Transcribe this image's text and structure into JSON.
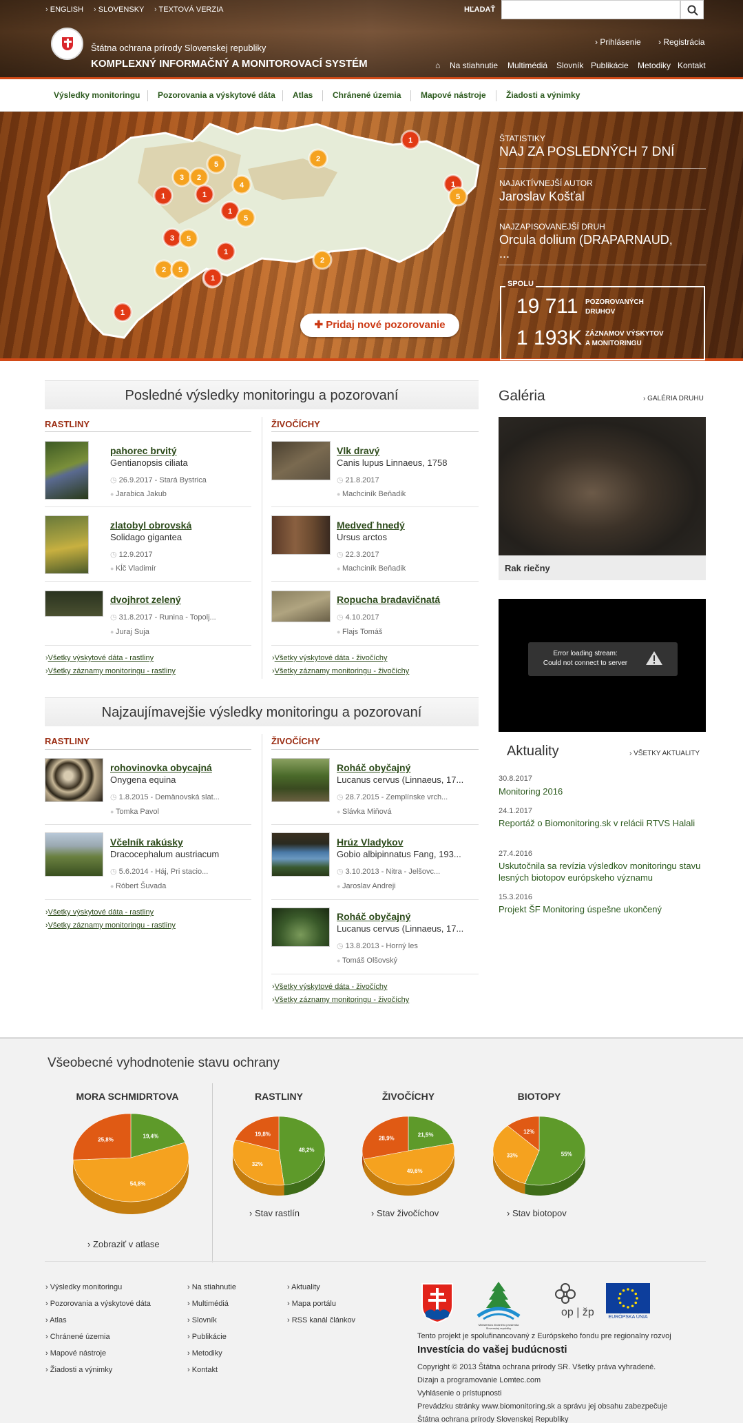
{
  "header": {
    "lang_links": [
      "ENGLISH",
      "SLOVENSKY",
      "TEXTOVÁ VERZIA"
    ],
    "search_label": "HĽADAŤ",
    "search_placeholder": "",
    "org_name": "Štátna ochrana prírody Slovenskej republiky",
    "system_name": "KOMPLEXNÝ INFORMAČNÝ A MONITOROVACÍ SYSTÉM",
    "user_links": [
      "Prihlásenie",
      "Registrácia"
    ],
    "main_nav": [
      "Na stiahnutie",
      "Multimédiá",
      "Slovník",
      "Publikácie",
      "Metodiky",
      "Kontakt"
    ]
  },
  "category_nav": [
    "Výsledky monitoringu",
    "Pozorovania a výskytové dáta",
    "Atlas",
    "Chránené územia",
    "Mapové nástroje",
    "Žiadosti a výnimky"
  ],
  "hero": {
    "map_markers": [
      "1",
      "3",
      "2",
      "5",
      "2",
      "1",
      "1",
      "4",
      "1",
      "5",
      "1",
      "5",
      "3",
      "5",
      "1",
      "2",
      "5",
      "1",
      "2",
      "1",
      "5",
      "1"
    ],
    "stats_kicker": "ŠTATISTIKY",
    "stats_title": "NAJ ZA POSLEDNÝCH 7 DNÍ",
    "author_kicker": "NAJAKTÍVNEJŠÍ AUTOR",
    "author_name": "Jaroslav Košťal",
    "species_kicker": "NAJZAPISOVANEJŠÍ DRUH",
    "species_name": "Orcula dolium (DRAPARNAUD,",
    "species_more": "...",
    "total_label": "SPOLU",
    "total_species_num": "19 711",
    "total_species_label_1": "POZOROVANÝCH",
    "total_species_label_2": "DRUHOV",
    "total_records_num": "1 193K",
    "total_records_label_1": "ZÁZNAMOV VÝSKYTOV",
    "total_records_label_2": "A MONITORINGU",
    "add_button": "Pridaj nové pozorovanie"
  },
  "recent": {
    "title": "Posledné výsledky monitoringu a pozorovaní",
    "plants_header": "RASTLINY",
    "animals_header": "ŽIVOČÍCHY",
    "plants": [
      {
        "name": "pahorec brvitý",
        "latin": "Gentianopsis ciliata",
        "meta": "26.9.2017 - Stará Bystrica",
        "user": "Jarabica Jakub"
      },
      {
        "name": "zlatobyl obrovská",
        "latin": "Solidago gigantea",
        "meta": "12.9.2017",
        "user": "Kĺč Vladimír"
      },
      {
        "name": "dvojhrot zelený",
        "latin": "",
        "meta": "31.8.2017 - Runina - Topolj...",
        "user": "Juraj Suja"
      }
    ],
    "animals": [
      {
        "name": "Vlk dravý",
        "latin": "Canis lupus Linnaeus, 1758",
        "meta": "21.8.2017",
        "user": "Machciník Beňadik"
      },
      {
        "name": "Medveď hnedý",
        "latin": "Ursus arctos",
        "meta": "22.3.2017",
        "user": "Machciník Beňadik"
      },
      {
        "name": "Ropucha bradavičnatá",
        "latin": "",
        "meta": "4.10.2017",
        "user": "Flajs Tomáš"
      }
    ],
    "plant_links": [
      "Všetky výskytové dáta - rastliny",
      "Všetky záznamy monitoringu - rastliny"
    ],
    "animal_links": [
      "Všetky výskytové dáta - živočíchy",
      "Všetky záznamy monitoringu - živočíchy"
    ]
  },
  "interesting": {
    "title": "Najzaujímavejšie výsledky monitoringu a pozorovaní",
    "plants_header": "RASTLINY",
    "animals_header": "ŽIVOČÍCHY",
    "plants": [
      {
        "name": "rohovinovka obycajná",
        "latin": "Onygena equina",
        "meta": "1.8.2015 - Demänovská slat...",
        "user": "Tomka Pavol"
      },
      {
        "name": "Včelník rakúsky",
        "latin": "Dracocephalum austriacum",
        "meta": "5.6.2014 - Háj, Pri stacio...",
        "user": "Róbert Šuvada"
      }
    ],
    "animals": [
      {
        "name": "Roháč obyčajný",
        "latin": "Lucanus cervus (Linnaeus, 17...",
        "meta": "28.7.2015 - Zemplínske vrch...",
        "user": "Slávka Miňová"
      },
      {
        "name": "Hrúz Vladykov",
        "latin": "Gobio albipinnatus Fang, 193...",
        "meta": "3.10.2013 - Nitra - Jelšovc...",
        "user": "Jaroslav Andreji"
      },
      {
        "name": "Roháč obyčajný",
        "latin": "Lucanus cervus (Linnaeus, 17...",
        "meta": "13.8.2013 - Horný les",
        "user": "Tomáš Olšovský"
      }
    ],
    "plant_links": [
      "Všetky výskytové dáta - rastliny",
      "Všetky záznamy monitoringu - rastliny"
    ],
    "animal_links": [
      "Všetky výskytové dáta - živočíchy",
      "Všetky záznamy monitoringu - živočíchy"
    ]
  },
  "gallery": {
    "title": "Galéria",
    "link": "GALÉRIA DRUHU",
    "caption": "Rak riečny"
  },
  "video": {
    "error_line1": "Error loading stream:",
    "error_line2": "Could not connect to server"
  },
  "news": {
    "title": "Aktuality",
    "link": "VŠETKY AKTUALITY",
    "items": [
      {
        "date": "30.8.2017",
        "title": "Monitoring 2016"
      },
      {
        "date": "24.1.2017",
        "title": "Reportáž o Biomonitoring.sk v relácii RTVS Halali"
      },
      {
        "date": "27.4.2016",
        "title": "Uskutočnila sa revízia výsledkov monitoringu stavu lesných biotopov európskeho významu"
      },
      {
        "date": "15.3.2016",
        "title": "Projekt ŠF Monitoring úspešne ukončený"
      }
    ]
  },
  "evaluation": {
    "title": "Všeobecné vyhodnotenie stavu ochrany",
    "atlas_link": "Zobraziť v atlase",
    "colors": {
      "green": "#5e9a2a",
      "orange": "#f5a21f",
      "red": "#e05a14"
    }
  },
  "chart_data": [
    {
      "type": "pie",
      "title": "MORA SCHMIDRTOVA",
      "labels": [
        "19,4%",
        "54,8%",
        "25,8%"
      ],
      "values": [
        19.4,
        54.8,
        25.8
      ],
      "colors": [
        "#5e9a2a",
        "#f5a21f",
        "#e05a14"
      ]
    },
    {
      "type": "pie",
      "title": "RASTLINY",
      "labels": [
        "48,2%",
        "32%",
        "19,8%"
      ],
      "values": [
        48.2,
        32,
        19.8
      ],
      "colors": [
        "#5e9a2a",
        "#f5a21f",
        "#e05a14"
      ],
      "link": "Stav rastlín"
    },
    {
      "type": "pie",
      "title": "ŽIVOČÍCHY",
      "labels": [
        "21,5%",
        "49,6%",
        "28,9%"
      ],
      "values": [
        21.5,
        49.6,
        28.9
      ],
      "colors": [
        "#5e9a2a",
        "#f5a21f",
        "#e05a14"
      ],
      "link": "Stav živočíchov"
    },
    {
      "type": "pie",
      "title": "BIOTOPY",
      "labels": [
        "55%",
        "33%",
        "12%"
      ],
      "values": [
        55,
        33,
        12
      ],
      "colors": [
        "#5e9a2a",
        "#f5a21f",
        "#e05a14"
      ],
      "link": "Stav biotopov"
    }
  ],
  "footer": {
    "col1": [
      "Výsledky monitoringu",
      "Pozorovania a výskytové dáta",
      "Atlas",
      "Chránené územia",
      "Mapové nástroje",
      "Žiadosti a výnimky"
    ],
    "col2": [
      "Na stiahnutie",
      "Multimédiá",
      "Slovník",
      "Publikácie",
      "Metodiky",
      "Kontakt"
    ],
    "col3": [
      "Aktuality",
      "Mapa portálu",
      "RSS kanál článkov"
    ],
    "logo_ministry_caption": "Ministerstvo životného prostredia Slovenskej republiky",
    "logo_op": "op | žp",
    "logo_eu": "EURÓPSKA ÚNIA",
    "cofinance": "Tento projekt je spolufinancovaný z Európskeho fondu pre regionalny rozvoj",
    "slogan": "Investícia do vašej budúcnosti",
    "copyright": "Copyright © 2013 Štátna ochrana prírody SR. Všetky práva vyhradené.",
    "design": "Dizajn a programovanie Lomtec.com",
    "accessibility": "Vyhlásenie o prístupnosti",
    "operator": "Prevádzku stránky www.biomonitoring.sk a správu jej obsahu zabezpečuje",
    "operator_org": "Štátna ochrana prírody Slovenskej Republiky"
  }
}
